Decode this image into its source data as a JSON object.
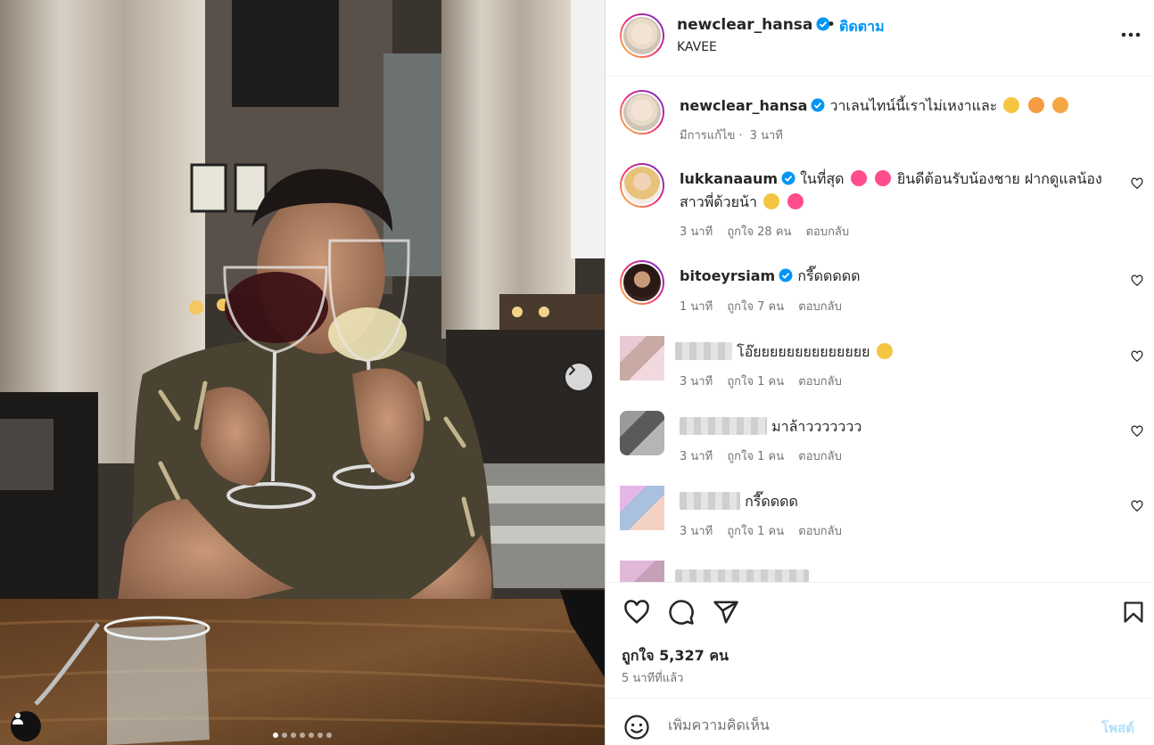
{
  "post": {
    "author": "newclear_hansa",
    "follow_label": "ติดตาม",
    "location": "KAVEE",
    "caption_text": "วาเลนไทน์นี้เราไม่เหงาและ",
    "caption_meta_edited": "มีการแก้ไข",
    "caption_meta_time": "3 นาที",
    "photo_count": 7,
    "active_photo_index": 0
  },
  "comments": [
    {
      "username": "lukkanaaum",
      "text_1": "ในที่สุด",
      "text_2": "ยินดีต้อนรับน้องชาย ฝากดูแลน้อง",
      "text_3": "สาวพี่ด้วยน้า",
      "time": "3 นาที",
      "likes": "ถูกใจ 28 คน",
      "reply": "ตอบกลับ"
    },
    {
      "username": "bitoeyrsiam",
      "text": "กรี๊ดดดดด",
      "time": "1 นาที",
      "likes": "ถูกใจ 7 คน",
      "reply": "ตอบกลับ"
    },
    {
      "text": "โอ๊ยยยยยยยยยยยยยย",
      "time": "3 นาที",
      "likes": "ถูกใจ 1 คน",
      "reply": "ตอบกลับ"
    },
    {
      "text": "มาล้าววววววว",
      "time": "3 นาที",
      "likes": "ถูกใจ 1 คน",
      "reply": "ตอบกลับ"
    },
    {
      "text": "กรี๊ดดดด",
      "time": "3 นาที",
      "likes": "ถูกใจ 1 คน",
      "reply": "ตอบกลับ"
    }
  ],
  "likes_text": "ถูกใจ 5,327 คน",
  "posted_time": "5 นาทีที่แล้ว",
  "add_comment": {
    "placeholder": "เพิ่มความคิดเห็น",
    "post_label": "โพสต์"
  },
  "icons": {
    "verified": "verified-badge-icon",
    "more": "more-options-icon",
    "like": "heart-icon",
    "comment": "comment-icon",
    "share": "share-icon",
    "save": "bookmark-icon",
    "emoji": "emoji-smile-icon",
    "next": "chevron-right-icon",
    "tag": "user-tag-icon"
  },
  "colors": {
    "accent": "#0095f6",
    "verified": "#0095f6",
    "heart_emoji": "#ff4d8d"
  }
}
